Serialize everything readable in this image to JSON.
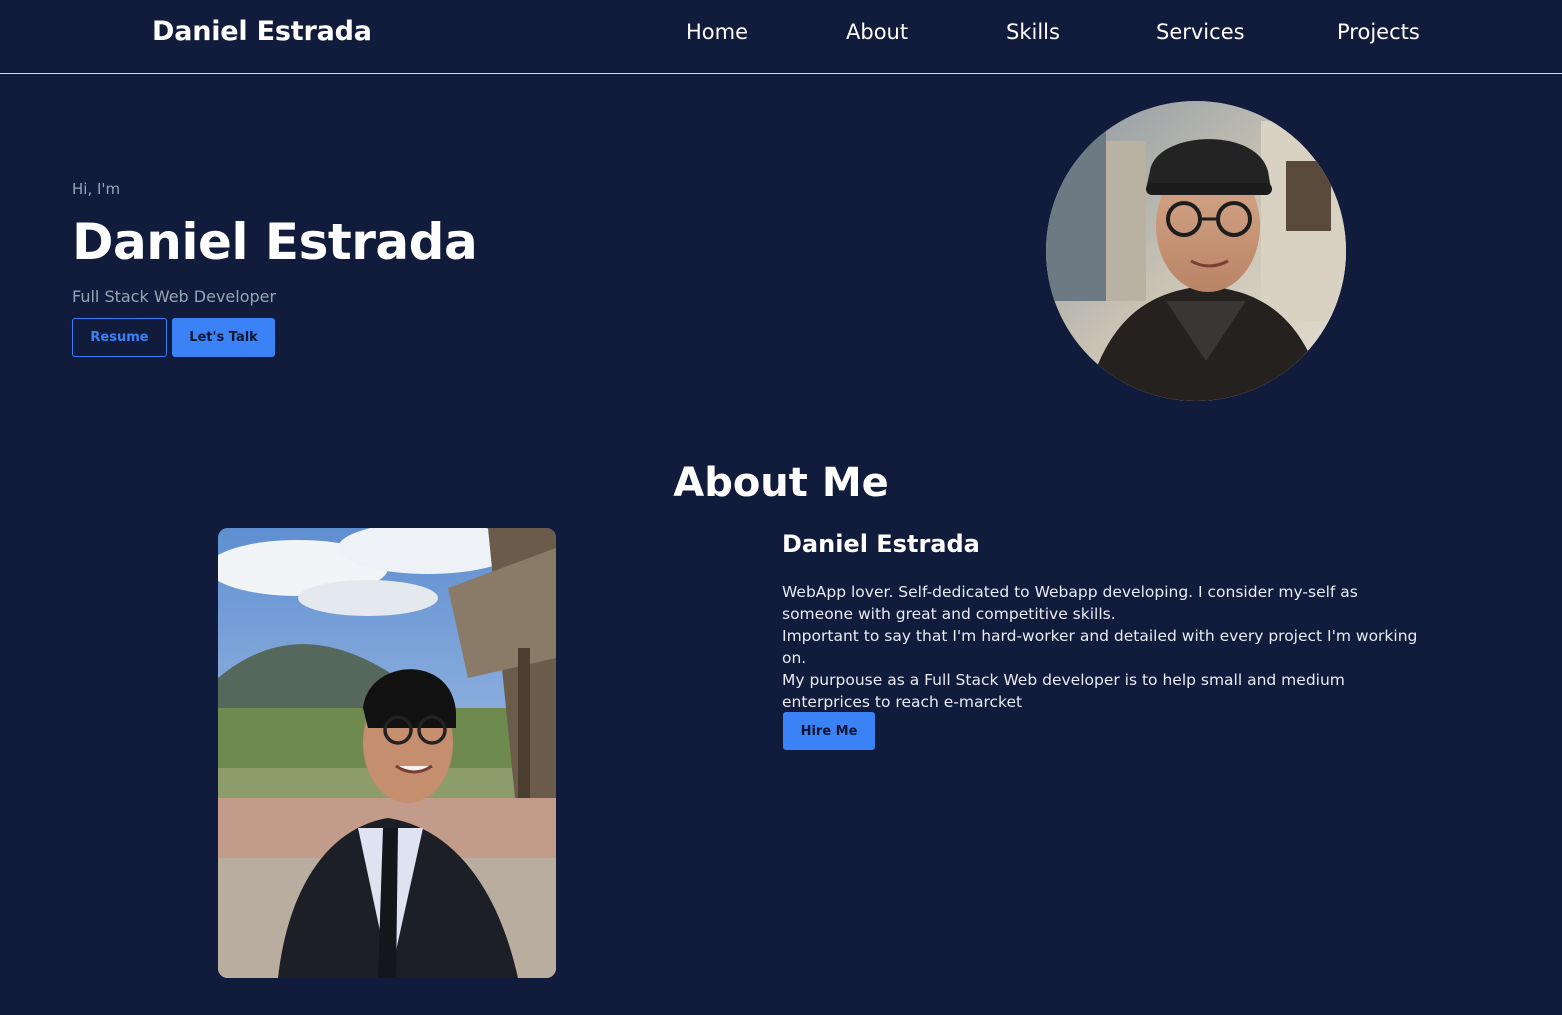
{
  "navbar": {
    "brand": "Daniel Estrada",
    "links": [
      "Home",
      "About",
      "Skills",
      "Services",
      "Projects"
    ]
  },
  "hero": {
    "greeting": "Hi, I'm",
    "name": "Daniel Estrada",
    "role": "Full Stack Web Developer",
    "resume_label": "Resume",
    "talk_label": "Let's Talk"
  },
  "about": {
    "title": "About Me",
    "name": "Daniel Estrada",
    "bio": [
      "WebApp lover. Self-dedicated to Webapp developing. I consider my-self as someone with great and competitive skills.",
      "Important to say that I'm hard-worker and detailed with every project I'm working on.",
      "My purpouse as a Full Stack Web developer is to help small and medium enterprices to reach e-marcket"
    ],
    "hire_label": "Hire Me"
  },
  "colors": {
    "background": "#111b3b",
    "accent": "#3b82f6",
    "muted_text": "#9ba3b6"
  }
}
